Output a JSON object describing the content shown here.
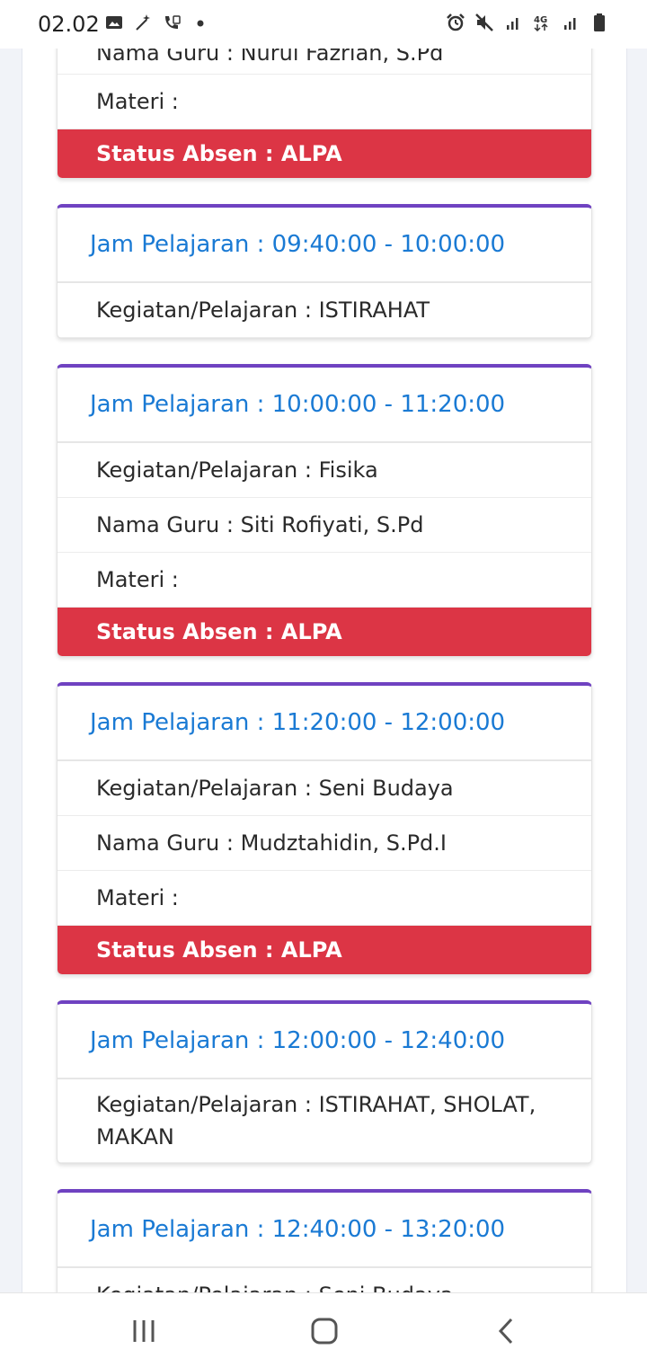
{
  "statusbar": {
    "time": "02.02",
    "left_icons": [
      "image-icon",
      "magic-wand-icon",
      "call-forward-icon",
      "dot-icon"
    ],
    "right_icons": [
      "alarm-icon",
      "mute-icon",
      "signal-icon",
      "network-4g-icon",
      "signal-icon-2",
      "battery-icon"
    ],
    "network_label": "4G"
  },
  "cards": [
    {
      "header": "",
      "rows": [
        "Nama Guru : Nurul Fazriah, S.Pd",
        "Materi :"
      ],
      "status": "Status Absen : ALPA"
    },
    {
      "header": "Jam Pelajaran : 09:40:00 - 10:00:00",
      "rows": [
        "Kegiatan/Pelajaran : ISTIRAHAT"
      ],
      "status": ""
    },
    {
      "header": "Jam Pelajaran : 10:00:00 - 11:20:00",
      "rows": [
        "Kegiatan/Pelajaran : Fisika",
        "Nama Guru : Siti Rofiyati, S.Pd",
        "Materi :"
      ],
      "status": "Status Absen : ALPA"
    },
    {
      "header": "Jam Pelajaran : 11:20:00 - 12:00:00",
      "rows": [
        "Kegiatan/Pelajaran : Seni Budaya",
        "Nama Guru : Mudztahidin, S.Pd.I",
        "Materi :"
      ],
      "status": "Status Absen : ALPA"
    },
    {
      "header": "Jam Pelajaran : 12:00:00 - 12:40:00",
      "rows": [
        "Kegiatan/Pelajaran : ISTIRAHAT, SHOLAT, MAKAN"
      ],
      "status": ""
    },
    {
      "header": "Jam Pelajaran : 12:40:00 - 13:20:00",
      "rows": [
        "Kegiatan/Pelajaran : Seni Budaya",
        ""
      ],
      "status": ""
    }
  ],
  "navbar": {
    "buttons": [
      "recent-apps-icon",
      "home-icon",
      "back-icon"
    ]
  },
  "colors": {
    "accent_border": "#6f42c1",
    "header_text": "#1a7ad4",
    "status_bg": "#dc3545"
  }
}
